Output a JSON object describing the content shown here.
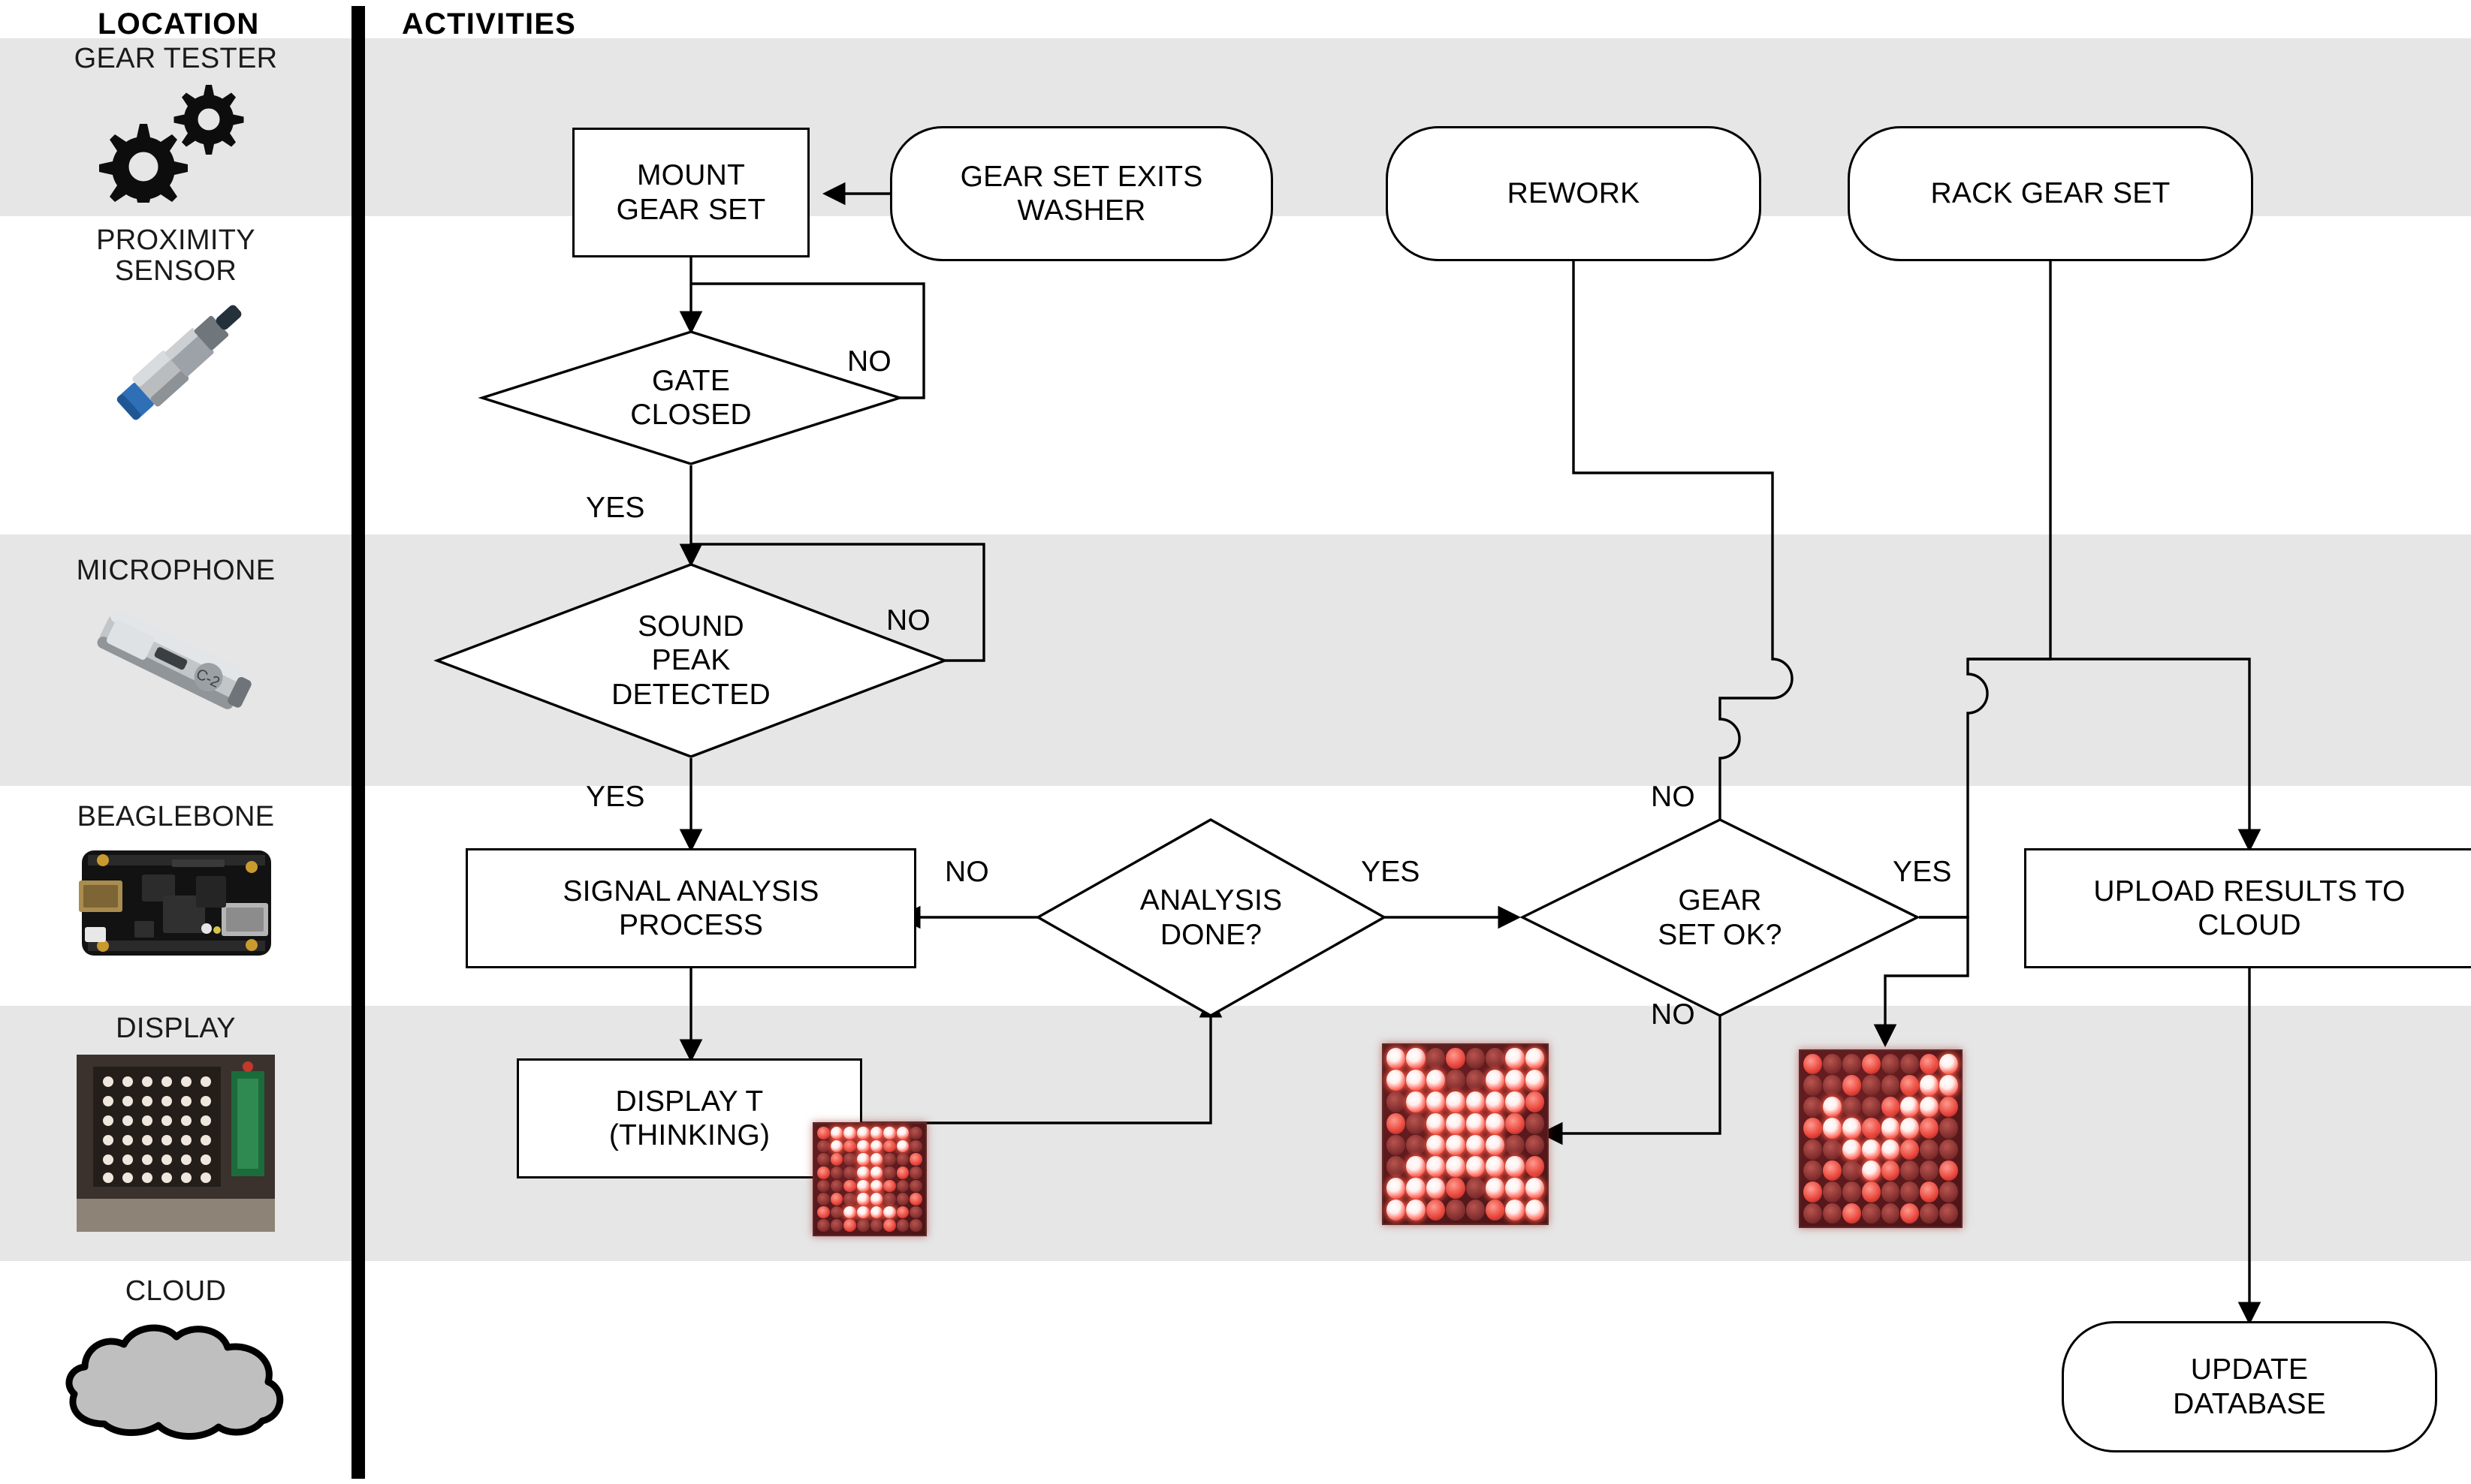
{
  "headers": {
    "location": "LOCATION",
    "activities": "ACTIVITIES"
  },
  "locations": [
    {
      "label": "GEAR TESTER",
      "icon": "gears-icon"
    },
    {
      "label": "PROXIMITY\nSENSOR",
      "icon": "proximity-sensor-photo"
    },
    {
      "label": "MICROPHONE",
      "icon": "microphone-photo"
    },
    {
      "label": "BEAGLEBONE",
      "icon": "beaglebone-board-photo"
    },
    {
      "label": "DISPLAY",
      "icon": "led-display-module-photo"
    },
    {
      "label": "CLOUD",
      "icon": "cloud-icon"
    }
  ],
  "nodes": {
    "mount_gear_set": {
      "label": "MOUNT\nGEAR SET",
      "shape": "process"
    },
    "gear_exits_washer": {
      "label": "GEAR SET EXITS\nWASHER",
      "shape": "terminator"
    },
    "rework": {
      "label": "REWORK",
      "shape": "terminator"
    },
    "rack_gear_set": {
      "label": "RACK GEAR SET",
      "shape": "terminator"
    },
    "gate_closed": {
      "label": "GATE\nCLOSED",
      "shape": "decision"
    },
    "sound_peak": {
      "label": "SOUND\nPEAK\nDETECTED",
      "shape": "decision"
    },
    "signal_analysis": {
      "label": "SIGNAL ANALYSIS\nPROCESS",
      "shape": "process"
    },
    "analysis_done": {
      "label": "ANALYSIS\nDONE?",
      "shape": "decision"
    },
    "gear_set_ok": {
      "label": "GEAR\nSET OK?",
      "shape": "decision"
    },
    "upload_results": {
      "label": "UPLOAD RESULTS TO\nCLOUD",
      "shape": "process"
    },
    "display_t": {
      "label": "DISPLAY T\n(THINKING)",
      "shape": "process"
    },
    "update_database": {
      "label": "UPDATE\nDATABASE",
      "shape": "terminator"
    }
  },
  "edge_labels": {
    "gate_no": "NO",
    "gate_yes": "YES",
    "sound_no": "NO",
    "sound_yes": "YES",
    "analysis_no": "NO",
    "analysis_yes": "YES",
    "gear_ok_no_top": "NO",
    "gear_ok_yes": "YES",
    "gear_ok_no_bottom": "NO"
  },
  "led_displays": [
    {
      "name": "display-t-thinking",
      "glyph": "T"
    },
    {
      "name": "display-x-fail",
      "glyph": "X"
    },
    {
      "name": "display-check-pass",
      "glyph": "CHECK"
    }
  ],
  "colors": {
    "band": "#e6e6e6",
    "stroke": "#000000",
    "node_fill": "#ffffff",
    "cloud_fill": "#bfbfbf",
    "led_on": "#ffffff",
    "led_off": "#7d2b2b"
  }
}
